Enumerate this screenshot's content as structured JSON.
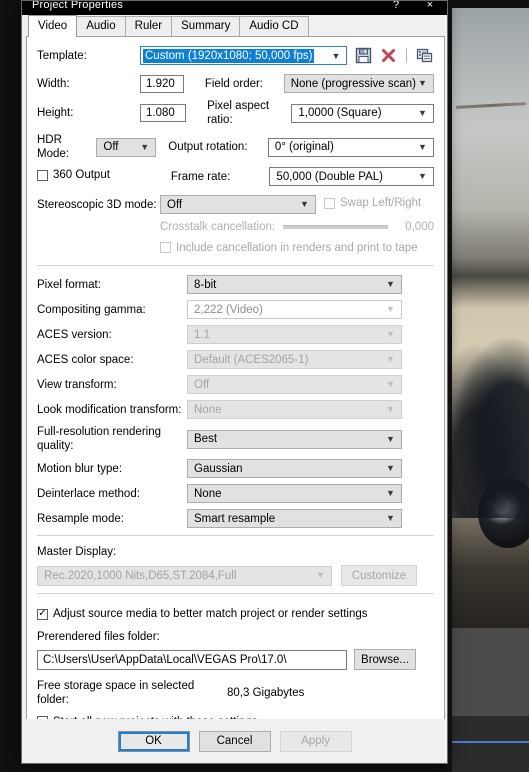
{
  "window": {
    "title": "Project Properties",
    "help_label": "?",
    "close_label": "×"
  },
  "tabs": [
    {
      "label": "Video",
      "active": true
    },
    {
      "label": "Audio",
      "active": false
    },
    {
      "label": "Ruler",
      "active": false
    },
    {
      "label": "Summary",
      "active": false
    },
    {
      "label": "Audio CD",
      "active": false
    }
  ],
  "template": {
    "label": "Template:",
    "value": "Custom (1920x1080; 50,000 fps)",
    "save_icon": "save-floppy-icon",
    "delete_icon": "delete-red-x-icon",
    "match_media_icon": "match-media-settings-icon"
  },
  "basic": {
    "width_label": "Width:",
    "width_value": "1.920",
    "height_label": "Height:",
    "height_value": "1.080",
    "hdr_label": "HDR Mode:",
    "hdr_value": "Off",
    "output360_label": "360 Output",
    "output360_checked": false,
    "field_order_label": "Field order:",
    "field_order_value": "None (progressive scan)",
    "par_label": "Pixel aspect ratio:",
    "par_value": "1,0000 (Square)",
    "rotation_label": "Output rotation:",
    "rotation_value": "0° (original)",
    "framerate_label": "Frame rate:",
    "framerate_value": "50,000 (Double PAL)"
  },
  "stereo": {
    "mode_label": "Stereoscopic 3D mode:",
    "mode_value": "Off",
    "swap_label": "Swap Left/Right",
    "swap_checked": false,
    "crosstalk_label": "Crosstalk cancellation:",
    "crosstalk_value": "0,000",
    "include_label": "Include cancellation in renders and print to tape",
    "include_checked": false
  },
  "properties": [
    {
      "label": "Pixel format:",
      "value": "8-bit",
      "state": "enabled"
    },
    {
      "label": "Compositing gamma:",
      "value": "2,222 (Video)",
      "state": "white-disabled"
    },
    {
      "label": "ACES version:",
      "value": "1.1",
      "state": "disabled"
    },
    {
      "label": "ACES color space:",
      "value": "Default (ACES2065-1)",
      "state": "disabled"
    },
    {
      "label": "View transform:",
      "value": "Off",
      "state": "disabled"
    },
    {
      "label": "Look modification transform:",
      "value": "None",
      "state": "disabled"
    },
    {
      "label": "Full-resolution rendering quality:",
      "value": "Best",
      "state": "enabled"
    },
    {
      "label": "Motion blur type:",
      "value": "Gaussian",
      "state": "enabled"
    },
    {
      "label": "Deinterlace method:",
      "value": "None",
      "state": "enabled"
    },
    {
      "label": "Resample mode:",
      "value": "Smart resample",
      "state": "enabled"
    }
  ],
  "master_display": {
    "label": "Master Display:",
    "value": "Rec.2020,1000 Nits,D65,ST.2084,Full",
    "customize_label": "Customize"
  },
  "bottom": {
    "adjust_label": "Adjust source media to better match project or render settings",
    "adjust_checked": true,
    "prerendered_label": "Prerendered files folder:",
    "prerendered_value": "C:\\Users\\User\\AppData\\Local\\VEGAS Pro\\17.0\\",
    "browse_label": "Browse...",
    "free_space_label": "Free storage space in selected folder:",
    "free_space_value": "80,3 Gigabytes",
    "start_all_label": "Start all new projects with these settings",
    "start_all_checked": false
  },
  "footer": {
    "ok_label": "OK",
    "cancel_label": "Cancel",
    "apply_label": "Apply"
  },
  "colors": {
    "accent_blue": "#0f7fd4",
    "focus_blue": "#1f7fd0",
    "dialog_bg": "#f0f0f0",
    "combo_bg": "#e1e1e1",
    "disabled_text": "#a3a3a3"
  }
}
